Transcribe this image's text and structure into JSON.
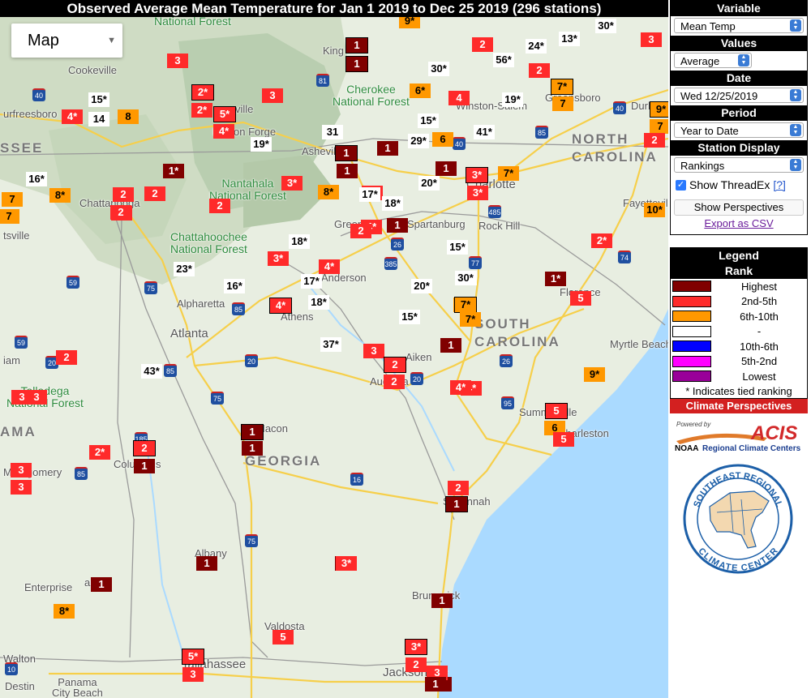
{
  "title": "Observed Average Mean Temperature for Jan 1 2019 to Dec 25 2019 (296 stations)",
  "map": {
    "type_button": "Map",
    "state_labels": [
      "TENNESSEE",
      "NORTH CAROLINA",
      "SOUTH CAROLINA",
      "GEORGIA",
      "ALABAMA"
    ],
    "forests": [
      "National Forest",
      "Cherokee National Forest",
      "Nantahala National Forest",
      "Chattahoochee National Forest",
      "Talladega National Forest"
    ],
    "cities": [
      "Cookeville",
      "urfreesboro",
      "Chattanooga",
      "Pigeon Forge",
      "Knoxville",
      "Asheville",
      "Greenville",
      "Spartanburg",
      "Charlotte",
      "Rock Hill",
      "Winston-Salem",
      "Greensboro",
      "Durham",
      "Fayetteville",
      "Florence",
      "Myrtle Beach",
      "Charleston",
      "Summerville",
      "Anderson",
      "Athens",
      "Alpharetta",
      "Atlanta",
      "Augusta",
      "Aiken",
      "Columbus",
      "Montgomery",
      "Macon",
      "Savannah",
      "Albany",
      "Valdosta",
      "Tallahassee",
      "Brunswick",
      "Jacksonville",
      "Enterprise",
      "Panama City Beach",
      "Destin",
      "Walton",
      "Birmingham",
      "Huntsville",
      "Kingsport"
    ],
    "markers": [
      {
        "t": "1",
        "r": "1",
        "b": true
      },
      {
        "t": "1",
        "r": "1",
        "b": true
      },
      {
        "t": "3",
        "r": "2"
      },
      {
        "t": "2*",
        "r": "2",
        "b": true
      },
      {
        "t": "5*",
        "r": "2",
        "b": true
      },
      {
        "t": "2*",
        "r": "2"
      },
      {
        "t": "4*",
        "r": "2"
      },
      {
        "t": "3",
        "r": "2"
      },
      {
        "t": "4*",
        "r": "2"
      },
      {
        "t": "8",
        "r": "6"
      },
      {
        "t": "2",
        "r": "2"
      },
      {
        "t": "1*",
        "r": "1"
      },
      {
        "t": "2",
        "r": "2"
      },
      {
        "t": "2",
        "r": "2"
      },
      {
        "t": "2",
        "r": "2"
      },
      {
        "t": "2",
        "r": "2"
      },
      {
        "t": "3*",
        "r": "2"
      },
      {
        "t": "8*",
        "r": "6"
      },
      {
        "t": "1",
        "r": "1",
        "b": true
      },
      {
        "t": "1",
        "r": "1"
      },
      {
        "t": "1",
        "r": "1"
      },
      {
        "t": "4*",
        "r": "2"
      },
      {
        "t": "4*",
        "r": "2"
      },
      {
        "t": "1",
        "r": "1"
      },
      {
        "t": "2",
        "r": "2"
      },
      {
        "t": "3*",
        "r": "2"
      },
      {
        "t": "4*",
        "r": "2"
      },
      {
        "t": "1",
        "r": "1"
      },
      {
        "t": "3*",
        "r": "2",
        "b": true
      },
      {
        "t": "3*",
        "r": "2"
      },
      {
        "t": "7*",
        "r": "6"
      },
      {
        "t": "8*",
        "r": "6"
      },
      {
        "t": "6*",
        "r": "6"
      },
      {
        "t": "4",
        "r": "2"
      },
      {
        "t": "6",
        "r": "6"
      },
      {
        "t": "2",
        "r": "2"
      },
      {
        "t": "7*",
        "r": "6",
        "b": true
      },
      {
        "t": "7",
        "r": "6"
      },
      {
        "t": "2*",
        "r": "2"
      },
      {
        "t": "7*",
        "r": "6"
      },
      {
        "t": "3",
        "r": "2"
      },
      {
        "t": "9*",
        "r": "6",
        "b": true
      },
      {
        "t": "7",
        "r": "6"
      },
      {
        "t": "2",
        "r": "2"
      },
      {
        "t": "10*",
        "r": "6"
      },
      {
        "t": "2*",
        "r": "2"
      },
      {
        "t": "1*",
        "r": "1"
      },
      {
        "t": "5",
        "r": "2"
      },
      {
        "t": "7*",
        "r": "6",
        "b": true
      },
      {
        "t": "7*",
        "r": "6"
      },
      {
        "t": "1",
        "r": "1"
      },
      {
        "t": "3",
        "r": "2"
      },
      {
        "t": "2",
        "r": "2",
        "b": true
      },
      {
        "t": "2",
        "r": "2"
      },
      {
        "t": "4*",
        "r": "2"
      },
      {
        "t": "9*",
        "r": "6"
      },
      {
        "t": "5",
        "r": "2",
        "b": true
      },
      {
        "t": "6",
        "r": "6"
      },
      {
        "t": "5",
        "r": "2"
      },
      {
        "t": "4*",
        "r": "2"
      },
      {
        "t": "2",
        "r": "2"
      },
      {
        "t": "1",
        "r": "1",
        "b": true
      },
      {
        "t": "1",
        "r": "1"
      },
      {
        "t": "2",
        "r": "2"
      },
      {
        "t": "3",
        "r": "2"
      },
      {
        "t": "1",
        "r": "1",
        "b": true
      },
      {
        "t": "1",
        "r": "1"
      },
      {
        "t": "2",
        "r": "2",
        "b": true
      },
      {
        "t": "1",
        "r": "1"
      },
      {
        "t": "2*",
        "r": "2"
      },
      {
        "t": "3",
        "r": "2"
      },
      {
        "t": "3",
        "r": "2"
      },
      {
        "t": "2",
        "r": "2"
      },
      {
        "t": "1",
        "r": "1"
      },
      {
        "t": "1",
        "r": "1"
      },
      {
        "t": "3*",
        "r": "2"
      },
      {
        "t": "1",
        "r": "1"
      },
      {
        "t": "8*",
        "r": "6"
      },
      {
        "t": "5",
        "r": "2"
      },
      {
        "t": "5*",
        "r": "2",
        "b": true
      },
      {
        "t": "3",
        "r": "2"
      },
      {
        "t": "1",
        "r": "1"
      },
      {
        "t": "3*",
        "r": "2",
        "b": true
      },
      {
        "t": "2",
        "r": "2"
      },
      {
        "t": "3",
        "r": "2"
      },
      {
        "t": "1",
        "r": "1"
      },
      {
        "t": "3",
        "r": "2"
      },
      {
        "t": "7",
        "r": "6"
      },
      {
        "t": "2",
        "r": "2"
      },
      {
        "t": "4*",
        "r": "2",
        "b": true
      },
      {
        "t": "15*",
        "r": "n"
      },
      {
        "t": "14",
        "r": "n"
      },
      {
        "t": "19*",
        "r": "n"
      },
      {
        "t": "31",
        "r": "n"
      },
      {
        "t": "16*",
        "r": "n"
      },
      {
        "t": "17*",
        "r": "n"
      },
      {
        "t": "18*",
        "r": "n"
      },
      {
        "t": "20*",
        "r": "n"
      },
      {
        "t": "15*",
        "r": "n"
      },
      {
        "t": "29*",
        "r": "n"
      },
      {
        "t": "41*",
        "r": "n"
      },
      {
        "t": "19*",
        "r": "n"
      },
      {
        "t": "30*",
        "r": "n"
      },
      {
        "t": "56*",
        "r": "n"
      },
      {
        "t": "24*",
        "r": "n"
      },
      {
        "t": "13*",
        "r": "n"
      },
      {
        "t": "30*",
        "r": "n"
      },
      {
        "t": "15*",
        "r": "n"
      },
      {
        "t": "18*",
        "r": "n"
      },
      {
        "t": "23*",
        "r": "n"
      },
      {
        "t": "16*",
        "r": "n"
      },
      {
        "t": "30*",
        "r": "n"
      },
      {
        "t": "17*",
        "r": "n"
      },
      {
        "t": "18*",
        "r": "n"
      },
      {
        "t": "20*",
        "r": "n"
      },
      {
        "t": "30*",
        "r": "n"
      },
      {
        "t": "15*",
        "r": "n"
      },
      {
        "t": "37*",
        "r": "n"
      },
      {
        "t": "43*",
        "r": "n"
      },
      {
        "t": "9*",
        "r": "6"
      },
      {
        "t": "3",
        "r": "2"
      },
      {
        "t": "2",
        "r": "2"
      },
      {
        "t": "7",
        "r": "6"
      }
    ],
    "roads": [
      "40",
      "75",
      "81",
      "26",
      "40",
      "85",
      "77",
      "485",
      "385",
      "26",
      "59",
      "75",
      "85",
      "20",
      "185",
      "16",
      "75",
      "10",
      "95",
      "74",
      "40",
      "26",
      "95",
      "20",
      "20",
      "16"
    ]
  },
  "panel": {
    "variable_head": "Variable",
    "variable_value": "Mean Temp",
    "values_head": "Values",
    "values_value": "Average",
    "date_head": "Date",
    "date_value": "Wed 12/25/2019",
    "period_head": "Period",
    "period_value": "Year to Date",
    "display_head": "Station Display",
    "display_value": "Rankings",
    "threadex_label": "Show ThreadEx",
    "threadex_help": "[?]",
    "perspectives_button": "Show Perspectives",
    "export_link": "Export as CSV"
  },
  "legend": {
    "head": "Legend",
    "subhead": "Rank",
    "rows": [
      {
        "label": "Highest",
        "color": "#800000"
      },
      {
        "label": "2nd-5th",
        "color": "#ff2a2a"
      },
      {
        "label": "6th-10th",
        "color": "#ff9800"
      },
      {
        "label": "-",
        "color": "#ffffff"
      },
      {
        "label": "10th-6th",
        "color": "#0000ff"
      },
      {
        "label": "5th-2nd",
        "color": "#ff00ff"
      },
      {
        "label": "Lowest",
        "color": "#990099"
      }
    ],
    "note": "* Indicates tied ranking"
  },
  "footer": {
    "perspectives": "Climate Perspectives",
    "powered_by": "Powered by",
    "acis": "ACIS",
    "noaa": "NOAA",
    "rcc": "Regional Climate Centers",
    "srcc_top": "SOUTHEAST REGIONAL",
    "srcc_bottom": "CLIMATE CENTER"
  }
}
